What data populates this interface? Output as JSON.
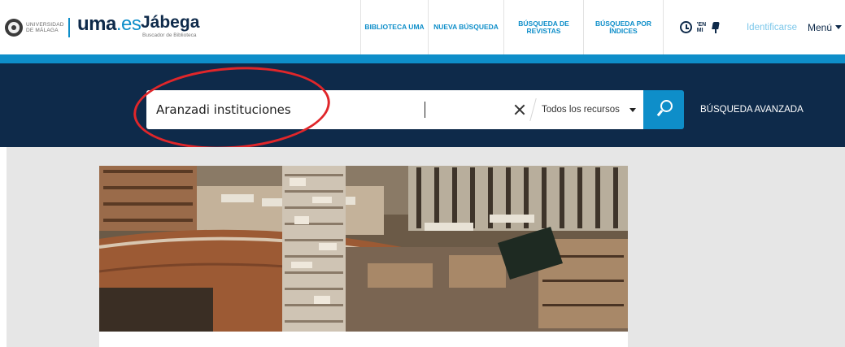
{
  "header": {
    "uni_text": [
      "UNIVERSIDAD",
      "DE MÁLAGA"
    ],
    "brand_uma": "uma",
    "brand_es": ".es",
    "brand_name": "Jábega",
    "brand_subtitle": "Buscador de Biblioteca",
    "nav": {
      "biblioteca": "BIBLIOTECA UMA",
      "nueva": "NUEVA BÚSQUEDA",
      "revistas": "BÚSQUEDA DE REVISTAS",
      "indices": "BÚSQUEDA POR ÍNDICES"
    },
    "tools_text": [
      "'EN",
      "MI"
    ],
    "login": "Identificarse",
    "menu": "Menú"
  },
  "search": {
    "query": "Aranzadi instituciones",
    "scope": "Todos los recursos",
    "advanced": "BÚSQUEDA AVANZADA"
  },
  "colors": {
    "navy": "#0e2a4a",
    "accent_blue": "#0e8ec9",
    "annotation_red": "#e0262a",
    "content_gray": "#e6e6e6"
  },
  "icons": {
    "history": "history-icon",
    "pin": "pin-icon",
    "clear": "clear-icon",
    "search": "search-icon",
    "caret": "chevron-down-icon"
  }
}
